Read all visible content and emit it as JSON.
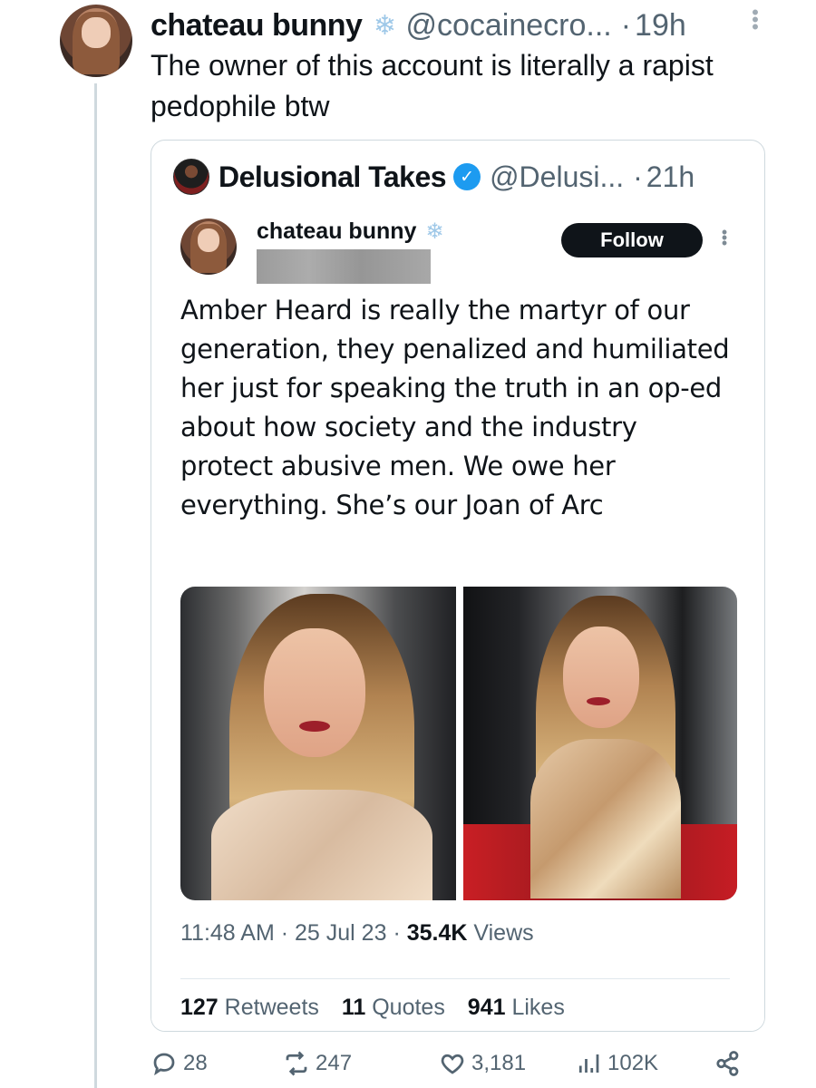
{
  "tweet": {
    "author_name": "chateau bunny",
    "handle": "@cocainecro...",
    "separator": "·",
    "time": "19h",
    "text": "The owner of this account is literally a rapist pedophile btw"
  },
  "quoted": {
    "author_name": "Delusional Takes",
    "handle": "@Delusi...",
    "separator": "·",
    "time": "21h",
    "screenshot": {
      "author_name": "chateau bunny",
      "follow_label": "Follow",
      "text": "Amber Heard is really the martyr of our generation, they penalized and humiliated her just for speaking the truth in an op-ed about how society and the industry protect abusive men. We owe her everything. She’s our Joan of Arc",
      "time": "11:48 AM",
      "date": "25 Jul 23",
      "views_count": "35.4K",
      "views_label": "Views",
      "meta_sep": "·",
      "retweets_count": "127",
      "retweets_label": "Retweets",
      "quotes_count": "11",
      "quotes_label": "Quotes",
      "likes_count": "941",
      "likes_label": "Likes"
    }
  },
  "actions": {
    "replies": "28",
    "reposts": "247",
    "likes": "3,181",
    "views": "102K"
  },
  "colors": {
    "verified": "#1d9bf0",
    "secondary_text": "#536471",
    "snowflake": "#9ec8e8"
  },
  "icons": {
    "verified": "verified-badge-icon",
    "snowflake": "snowflake-icon",
    "reply": "reply-icon",
    "repost": "repost-icon",
    "like": "heart-icon",
    "views": "analytics-icon",
    "share": "share-icon",
    "more": "more-vertical-icon"
  }
}
